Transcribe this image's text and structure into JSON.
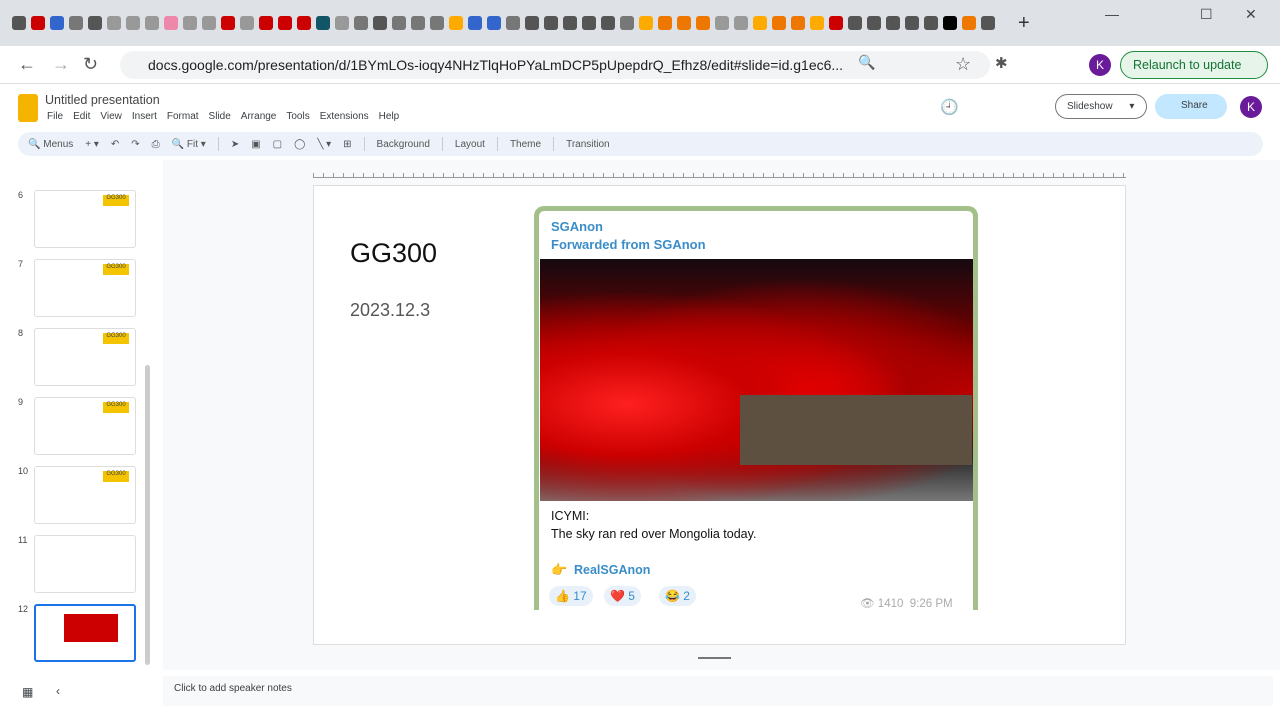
{
  "browser": {
    "url": "docs.google.com/presentation/d/1BYmLOs-ioqy4NHzTlqHoPYaLmDCP5pUpepdrQ_Efhz8/edit#slide=id.g1ec6...",
    "relaunch": "Relaunch to update",
    "avatar": "K",
    "tab_icon_colors": [
      "#555",
      "#c00",
      "#36c",
      "#777",
      "#555",
      "#999",
      "#999",
      "#999",
      "#e8a",
      "#999",
      "#999",
      "#c00",
      "#999",
      "#c00",
      "#c00",
      "#c00",
      "#156",
      "#999",
      "#777",
      "#555",
      "#777",
      "#777",
      "#777",
      "#fa0",
      "#36c",
      "#36c",
      "#777",
      "#555",
      "#555",
      "#555",
      "#555",
      "#555",
      "#777",
      "#fa0",
      "#e70",
      "#e70",
      "#e70",
      "#999",
      "#999",
      "#fa0",
      "#e70",
      "#e70",
      "#fa0",
      "#c00",
      "#555",
      "#555",
      "#555",
      "#555",
      "#555",
      "#000",
      "#e70",
      "#555"
    ]
  },
  "app": {
    "title": "Untitled presentation",
    "menus": [
      "File",
      "Edit",
      "View",
      "Insert",
      "Format",
      "Slide",
      "Arrange",
      "Tools",
      "Extensions",
      "Help"
    ],
    "toolbar": {
      "search": "Menus",
      "zoom": "Fit",
      "background": "Background",
      "layout": "Layout",
      "theme": "Theme",
      "transition": "Transition"
    },
    "slideshow": "Slideshow",
    "share": "Share",
    "avatar": "K"
  },
  "filmstrip": {
    "slides": [
      {
        "num": "6"
      },
      {
        "num": "7"
      },
      {
        "num": "8"
      },
      {
        "num": "9"
      },
      {
        "num": "10"
      },
      {
        "num": "11"
      },
      {
        "num": "12",
        "selected": true
      }
    ],
    "tag": "GG300"
  },
  "slide": {
    "title": "GG300",
    "date": "2023.12.3",
    "post": {
      "channel": "SGAnon",
      "forwarded": "Forwarded from SGAnon",
      "line1": "ICYMI:",
      "line2": "The sky ran red over Mongolia today.",
      "link": "RealSGAnon",
      "link_icon": "👉",
      "reactions": [
        {
          "emoji": "👍",
          "count": "17"
        },
        {
          "emoji": "❤️",
          "count": "5"
        },
        {
          "emoji": "😂",
          "count": "2"
        }
      ],
      "views": "1410",
      "time": "9:26 PM"
    }
  },
  "notes": "Click to add speaker notes"
}
